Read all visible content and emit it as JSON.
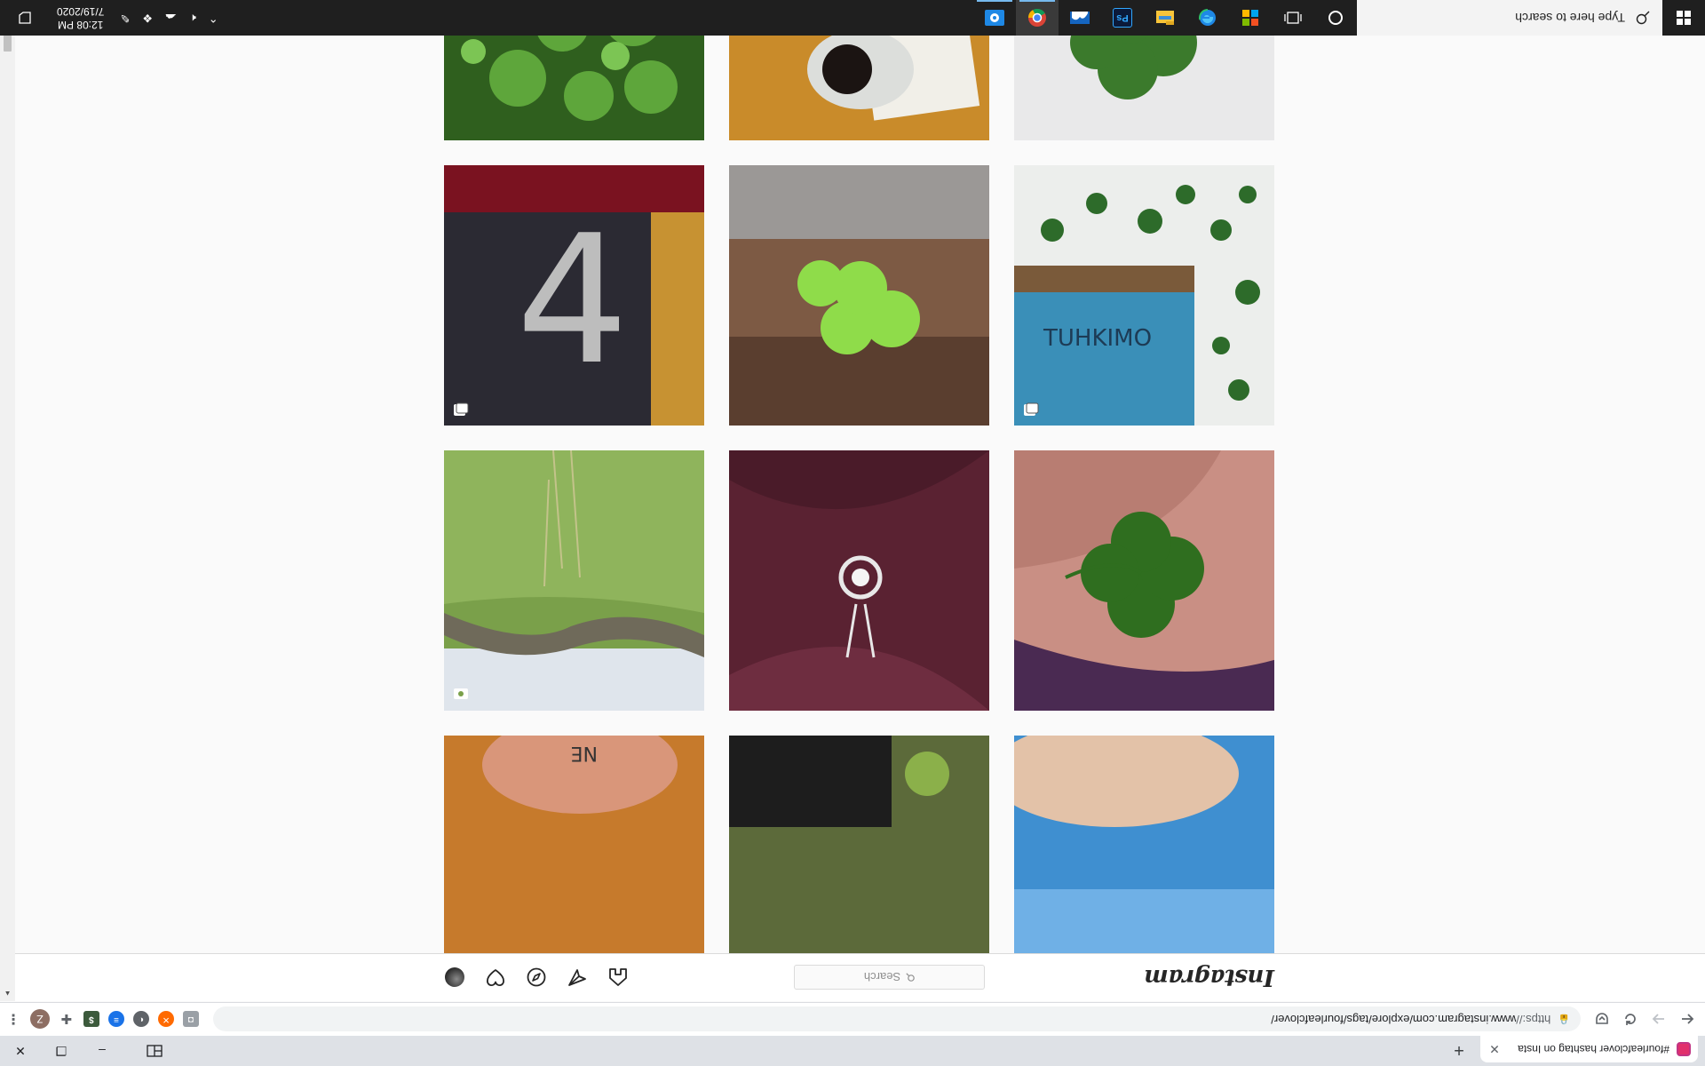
{
  "browser": {
    "tab": {
      "title": "#fourleafclover hashtag on Insta",
      "close_glyph": "✕"
    },
    "new_tab_glyph": "+",
    "window_controls": {
      "minimize": "–",
      "restore": "❐",
      "close": "✕"
    },
    "omnibox": {
      "scheme": "https://",
      "rest": "www.instagram.com/explore/tags/fourleafclover/"
    },
    "profile_initial": "Z"
  },
  "instagram": {
    "logo": "Instagram",
    "search_placeholder": "Search",
    "search_icon": "Q"
  },
  "grid": {
    "tiles": [
      {
        "name": "clover-patch-photo",
        "icon": null
      },
      {
        "name": "coffee-and-card-photo",
        "icon": null
      },
      {
        "name": "held-clover-photo",
        "icon": null
      },
      {
        "name": "painted-number-photo",
        "icon": "carousel-icon"
      },
      {
        "name": "clover-on-wood-photo",
        "icon": null
      },
      {
        "name": "book-with-clovers-photo",
        "icon": "carousel-icon"
      },
      {
        "name": "meadow-photo",
        "icon": "video-icon"
      },
      {
        "name": "pendant-photo",
        "icon": null
      },
      {
        "name": "clover-in-hand-photo",
        "icon": null
      }
    ]
  },
  "taskbar": {
    "search_placeholder": "Type here to search",
    "clock_time": "12:08 PM",
    "clock_date": "7/19/2020",
    "apps": [
      "task-view-icon",
      "cortana-icon",
      "windows-store-icon",
      "edge-icon",
      "file-explorer-icon",
      "photoshop-icon",
      "weather-app-icon",
      "chrome-icon",
      "settings-app-icon"
    ],
    "photoshop_label": "Ps"
  },
  "colors": {
    "taskbar_bg": "#1f1f1f",
    "instagram_border": "#dbdbdb",
    "chrome_tabstrip": "#dee1e6"
  }
}
